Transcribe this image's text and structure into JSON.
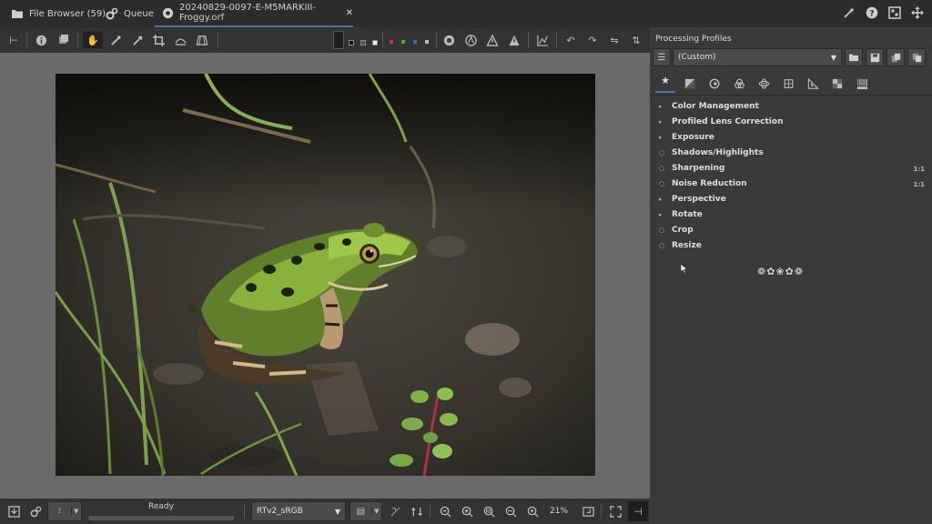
{
  "tabs": [
    {
      "label": "File Browser (59)",
      "icon": "folder-icon"
    },
    {
      "label": "Queue",
      "icon": "gears-icon"
    },
    {
      "label": "20240829-0097-E-M5MARKIII-Froggy.orf",
      "icon": "aperture-icon",
      "close": "✕"
    }
  ],
  "right_panel": {
    "title": "Processing Profiles",
    "profile_value": "(Custom)",
    "sections": [
      {
        "label": "Color Management",
        "marker": "▸",
        "badge": ""
      },
      {
        "label": "Profiled Lens Correction",
        "marker": "▸",
        "badge": ""
      },
      {
        "label": "Exposure",
        "marker": "▸",
        "badge": ""
      },
      {
        "label": "Shadows/Highlights",
        "marker": "○",
        "badge": ""
      },
      {
        "label": "Sharpening",
        "marker": "○",
        "badge": "1:1"
      },
      {
        "label": "Noise Reduction",
        "marker": "○",
        "badge": "1:1"
      },
      {
        "label": "Perspective",
        "marker": "▸",
        "badge": ""
      },
      {
        "label": "Rotate",
        "marker": "▸",
        "badge": ""
      },
      {
        "label": "Crop",
        "marker": "○",
        "badge": ""
      },
      {
        "label": "Resize",
        "marker": "○",
        "badge": ""
      }
    ],
    "ornament": "❁✿❀✿❁"
  },
  "bottom": {
    "status": "Ready",
    "output_profile": "RTv2_sRGB",
    "zoom": "21%"
  },
  "colors": {
    "accent": "#4a6fa5",
    "panel": "#3a3a3a",
    "viewer_bg": "#6a6a6a"
  }
}
